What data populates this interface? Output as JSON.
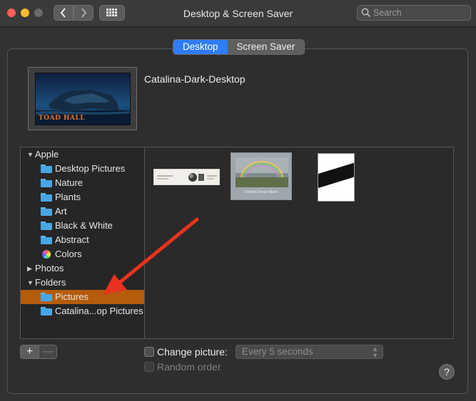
{
  "window": {
    "title": "Desktop & Screen Saver",
    "search_placeholder": "Search"
  },
  "tabs": [
    {
      "label": "Desktop",
      "active": true
    },
    {
      "label": "Screen Saver",
      "active": false
    }
  ],
  "preview": {
    "name": "Catalina-Dark-Desktop",
    "watermark": "TOAD HALL"
  },
  "sidebar": {
    "groups": [
      {
        "label": "Apple",
        "expanded": true
      },
      {
        "label": "Photos",
        "expanded": false
      },
      {
        "label": "Folders",
        "expanded": true
      }
    ],
    "apple_items": [
      "Desktop Pictures",
      "Nature",
      "Plants",
      "Art",
      "Black & White",
      "Abstract",
      "Colors"
    ],
    "folder_items": [
      "Pictures",
      "Catalina...op Pictures"
    ],
    "selected": "Pictures"
  },
  "thumbnails": [
    {
      "icon": "document-strip-thumbnail"
    },
    {
      "icon": "rainbow-album-thumbnail",
      "caption": "Untitled Smart Album"
    },
    {
      "icon": "diagonal-stripe-thumbnail"
    }
  ],
  "controls": {
    "add_label": "+",
    "remove_label": "—",
    "change_picture_label": "Change picture:",
    "change_picture_checked": false,
    "interval_value": "Every 5 seconds",
    "random_order_label": "Random order",
    "random_order_enabled": false,
    "help_label": "?"
  },
  "colors": {
    "accent": "#2e7cf6",
    "selection": "#b45c0b",
    "folder": "#48a6e2",
    "annotation_arrow": "#e8321e"
  }
}
